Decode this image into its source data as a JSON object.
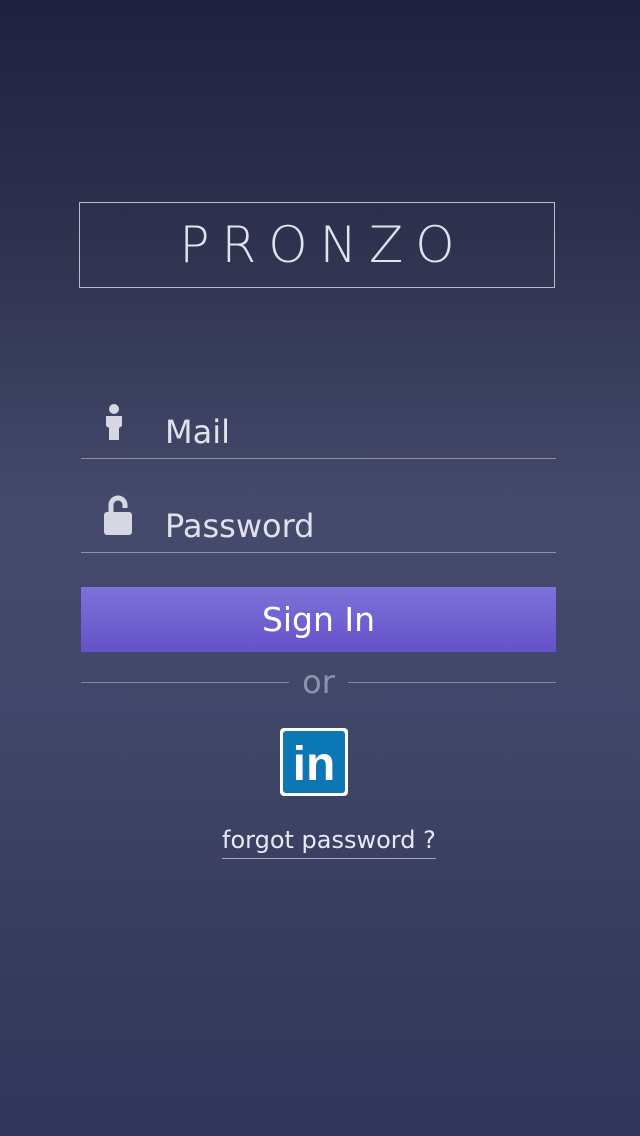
{
  "brand": {
    "logo_text": "PRONZO"
  },
  "form": {
    "mail": {
      "placeholder": "Mail",
      "value": "",
      "icon": "person-icon"
    },
    "password": {
      "placeholder": "Password",
      "value": "",
      "icon": "unlocked-padlock-icon"
    },
    "signin_label": "Sign In",
    "separator_text": "or",
    "social": {
      "icon": "linkedin-icon",
      "label": "in"
    },
    "forgot_label": "forgot password ?"
  },
  "colors": {
    "accent_button_top": "#7c72da",
    "accent_button_bottom": "#6552c8",
    "linkedin_blue": "#0b77b5",
    "background_top": "#1e2140",
    "background_bottom": "#30365a"
  }
}
